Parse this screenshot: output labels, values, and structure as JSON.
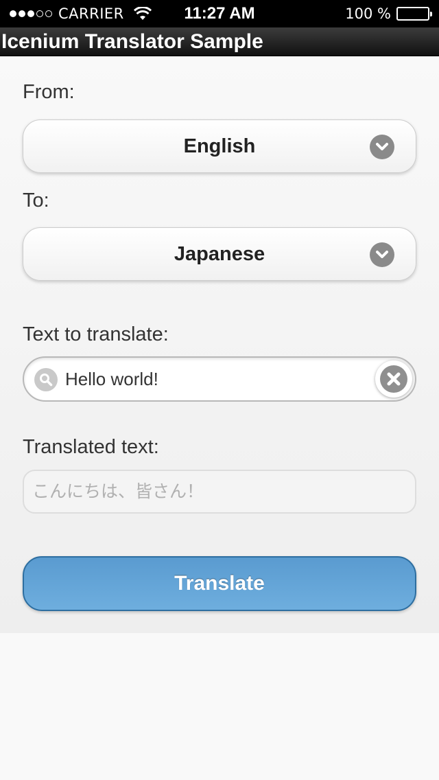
{
  "status_bar": {
    "carrier": "CARRIER",
    "time": "11:27 AM",
    "battery_percent": "100 %",
    "signal_bars_filled": 3,
    "signal_bars_total": 5,
    "battery_level": 1.0
  },
  "header": {
    "title": "Icenium Translator Sample"
  },
  "form": {
    "from_label": "From:",
    "from_value": "English",
    "to_label": "To:",
    "to_value": "Japanese",
    "input_label": "Text to translate:",
    "input_value": "Hello world!",
    "output_label": "Translated text:",
    "output_value": "こんにちは、皆さん！",
    "translate_button": "Translate"
  },
  "icons": {
    "from_dropdown": "chevron-down-icon",
    "to_dropdown": "chevron-down-icon",
    "search": "search-icon",
    "clear": "close-icon"
  },
  "colors": {
    "header_bg": "#1e1e1e",
    "button_primary": "#62a3d6",
    "button_border": "#2d6ea0",
    "icon_gray": "#8a8a8a"
  }
}
